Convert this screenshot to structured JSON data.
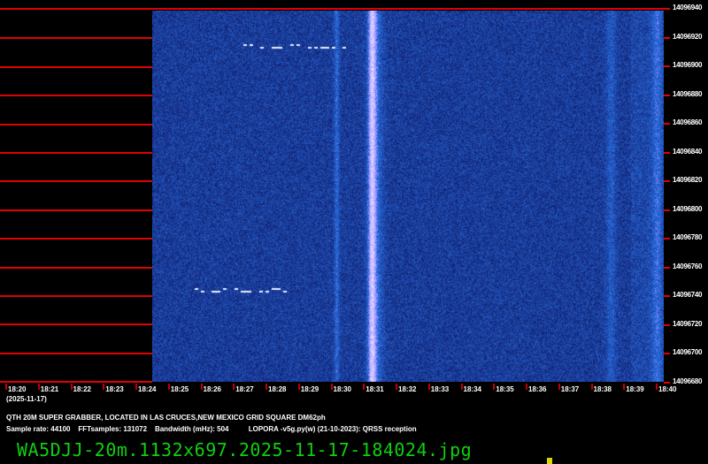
{
  "freq_labels": [
    "14096940",
    "14096920",
    "14096900",
    "14096880",
    "14096860",
    "14096840",
    "14096820",
    "14096800",
    "14096780",
    "14096760",
    "14096740",
    "14096720",
    "14096700",
    "14096680"
  ],
  "time_labels": [
    "18:20",
    "18:21",
    "18:22",
    "18:23",
    "18:24",
    "18:25",
    "18:26",
    "18:27",
    "18:28",
    "18:29",
    "18:30",
    "18:31",
    "18:32",
    "18:33",
    "18:34",
    "18:35",
    "18:36",
    "18:37",
    "18:38",
    "18:39",
    "18:40"
  ],
  "date_label": "(2025-11-17)",
  "info_line1": "QTH 20M SUPER GRABBER, LOCATED IN LAS CRUCES,NEW MEXICO GRID SQUARE DM62ph",
  "info_line2": "Sample rate: 44100    FFTsamples: 131072    Bandwidth (mHz): 504          LOPORA -v5g.py(w) (21-10-2023): QRSS reception",
  "filename": "WA5DJJ-20m.1132x697.2025-11-17-184024.jpg",
  "colors": {
    "background": "#000000",
    "grid_red": "#e00000",
    "spectrum_blue": "#1a2f8c",
    "filename_green": "#10d010"
  }
}
